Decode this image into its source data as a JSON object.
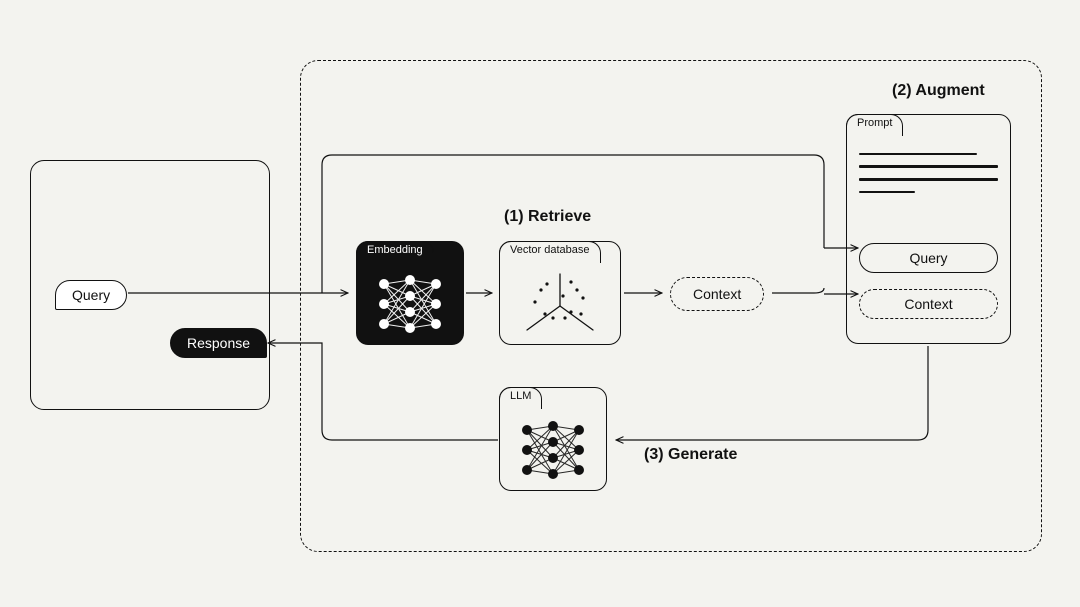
{
  "bubbles": {
    "query": "Query",
    "response": "Response"
  },
  "stages": {
    "retrieve": "(1) Retrieve",
    "augment": "(2) Augment",
    "generate": "(3) Generate"
  },
  "cards": {
    "embedding": "Embedding",
    "vector_db": "Vector database",
    "llm": "LLM"
  },
  "prompt": {
    "title": "Prompt",
    "chip_query": "Query",
    "chip_context": "Context"
  },
  "context_pill": "Context"
}
